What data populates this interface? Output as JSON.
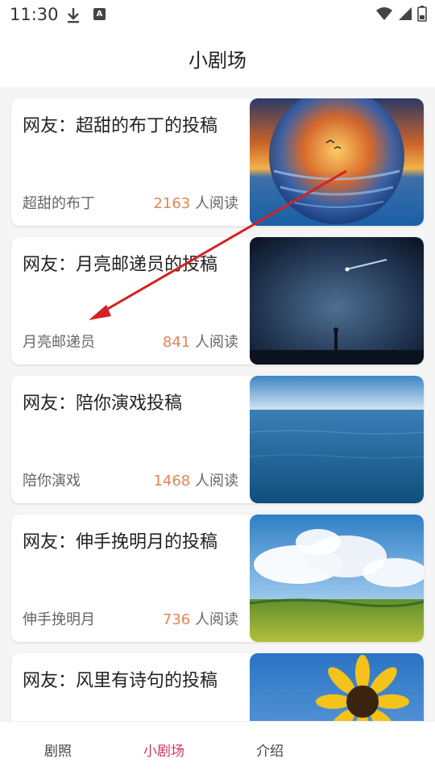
{
  "status_bar": {
    "time": "11:30"
  },
  "header": {
    "title": "小剧场"
  },
  "cards": [
    {
      "title": "网友：超甜的布丁的投稿",
      "author": "超甜的布丁",
      "read_count": "2163",
      "read_suffix": "人阅读"
    },
    {
      "title": "网友：月亮邮递员的投稿",
      "author": "月亮邮递员",
      "read_count": "841",
      "read_suffix": "人阅读"
    },
    {
      "title": "网友：陪你演戏投稿",
      "author": "陪你演戏",
      "read_count": "1468",
      "read_suffix": "人阅读"
    },
    {
      "title": "网友：伸手挽明月的投稿",
      "author": "伸手挽明月",
      "read_count": "736",
      "read_suffix": "人阅读"
    },
    {
      "title": "网友：风里有诗句的投稿",
      "author": "",
      "read_count": "",
      "read_suffix": ""
    }
  ],
  "bottom_nav": {
    "tabs": [
      {
        "label": "剧照"
      },
      {
        "label": "小剧场"
      },
      {
        "label": "介绍"
      }
    ],
    "active_index": 1
  },
  "colors": {
    "accent": "#d6336c",
    "read_count": "#e28557",
    "annotation_arrow": "#d42222"
  },
  "icons": [
    "download-icon",
    "a-notification-icon",
    "wifi-icon",
    "signal-icon",
    "battery-icon"
  ]
}
